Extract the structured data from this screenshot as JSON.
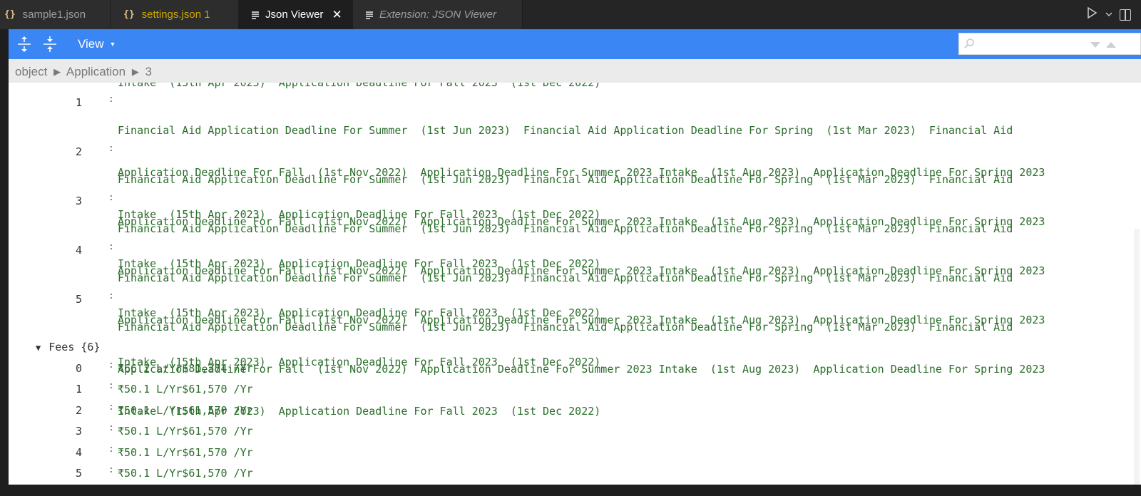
{
  "tabs": [
    {
      "icon": "{}",
      "label": "sample1.json"
    },
    {
      "icon": "{}",
      "label": "settings.json 1"
    },
    {
      "icon": "lines-icon",
      "label": "Json Viewer",
      "close": "✕"
    },
    {
      "icon": "lines-icon",
      "label": "Extension: JSON Viewer"
    }
  ],
  "toolbar": {
    "view_label": "View",
    "search_placeholder": ""
  },
  "breadcrumb": {
    "items": [
      "object",
      "Application",
      "3"
    ],
    "separator": "▶"
  },
  "application": {
    "partial_line": "Intake  (15th Apr 2023)  Application Deadline For Fall 2023  (1st Dec 2022)",
    "rows": [
      {
        "index": "1",
        "lines": [
          "Financial Aid Application Deadline For Summer  (1st Jun 2023)  Financial Aid Application Deadline For Spring  (1st Mar 2023)  Financial Aid",
          "Application Deadline For Fall  (1st Nov 2022)  Application Deadline For Summer 2023 Intake  (1st Aug 2023)  Application Deadline For Spring 2023",
          "Intake  (15th Apr 2023)  Application Deadline For Fall 2023  (1st Dec 2022)"
        ]
      },
      {
        "index": "2",
        "lines": [
          "Financial Aid Application Deadline For Summer  (1st Jun 2023)  Financial Aid Application Deadline For Spring  (1st Mar 2023)  Financial Aid",
          "Application Deadline For Fall  (1st Nov 2022)  Application Deadline For Summer 2023 Intake  (1st Aug 2023)  Application Deadline For Spring 2023",
          "Intake  (15th Apr 2023)  Application Deadline For Fall 2023  (1st Dec 2022)"
        ]
      },
      {
        "index": "3",
        "lines": [
          "Financial Aid Application Deadline For Summer  (1st Jun 2023)  Financial Aid Application Deadline For Spring  (1st Mar 2023)  Financial Aid",
          "Application Deadline For Fall  (1st Nov 2022)  Application Deadline For Summer 2023 Intake  (1st Aug 2023)  Application Deadline For Spring 2023",
          "Intake  (15th Apr 2023)  Application Deadline For Fall 2023  (1st Dec 2022)"
        ]
      },
      {
        "index": "4",
        "lines": [
          "Financial Aid Application Deadline For Summer  (1st Jun 2023)  Financial Aid Application Deadline For Spring  (1st Mar 2023)  Financial Aid",
          "Application Deadline For Fall  (1st Nov 2022)  Application Deadline For Summer 2023 Intake  (1st Aug 2023)  Application Deadline For Spring 2023",
          "Intake  (15th Apr 2023)  Application Deadline For Fall 2023  (1st Dec 2022)"
        ]
      },
      {
        "index": "5",
        "lines": [
          "Financial Aid Application Deadline For Summer  (1st Jun 2023)  Financial Aid Application Deadline For Spring  (1st Mar 2023)  Financial Aid",
          "Application Deadline For Fall  (1st Nov 2022)  Application Deadline For Summer 2023 Intake  (1st Aug 2023)  Application Deadline For Spring 2023",
          "Intake  (15th Apr 2023)  Application Deadline For Fall 2023  (1st Dec 2022)"
        ]
      }
    ]
  },
  "fees": {
    "toggle": "▼",
    "key": "Fees",
    "count": "{6}",
    "rows": [
      {
        "index": "0",
        "value": "₹66.2 L/Yr$81,374 /Yr"
      },
      {
        "index": "1",
        "value": "₹50.1 L/Yr$61,570 /Yr"
      },
      {
        "index": "2",
        "value": "₹50.1 L/Yr$61,570 /Yr"
      },
      {
        "index": "3",
        "value": "₹50.1 L/Yr$61,570 /Yr"
      },
      {
        "index": "4",
        "value": "₹50.1 L/Yr$61,570 /Yr"
      },
      {
        "index": "5",
        "value": "₹50.1 L/Yr$61,570 /Yr"
      }
    ]
  },
  "colors": {
    "toolbar": "#3a86f5",
    "value_text": "#2a6e2a",
    "tab_warning": "#cca700"
  }
}
